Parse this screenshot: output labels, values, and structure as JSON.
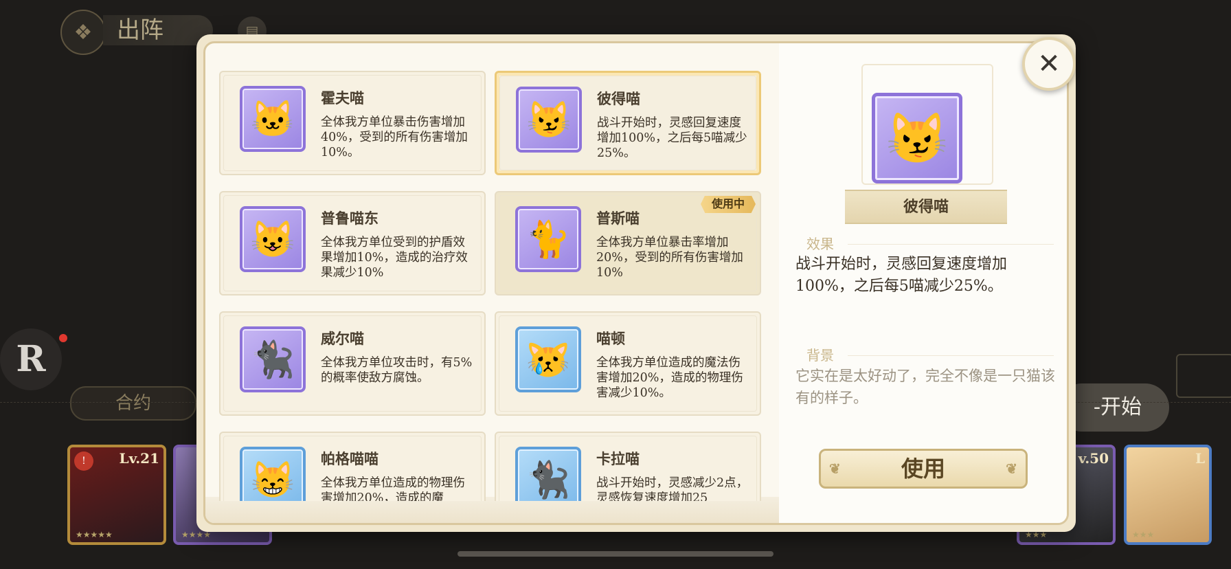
{
  "background": {
    "title": "出阵",
    "contract_label": "合约",
    "start_label": "-开始",
    "r_logo": "R",
    "cards": [
      {
        "level": "Lv.21"
      },
      {
        "level": ""
      },
      {
        "level": "v.50"
      },
      {
        "level": "L"
      }
    ]
  },
  "list": [
    {
      "name": "霍夫喵",
      "desc": "全体我方单位暴击伤害增加40%，受到的所有伤害增加10%。",
      "icon": "cat-icon",
      "frame": "purple",
      "emoji": "🐱"
    },
    {
      "name": "彼得喵",
      "desc": "战斗开始时，灵感回复速度增加100%，之后每5喵减少25%。",
      "icon": "cat-icon",
      "frame": "purple",
      "emoji": "😼",
      "selected": true
    },
    {
      "name": "普鲁喵东",
      "desc": "全体我方单位受到的护盾效果增加10%，造成的治疗效果减少10%",
      "icon": "cat-icon",
      "frame": "purple",
      "emoji": "😺"
    },
    {
      "name": "普斯喵",
      "desc": "全体我方单位暴击率增加20%，受到的所有伤害增加10%",
      "icon": "cat-icon",
      "frame": "purple",
      "emoji": "🐈",
      "tag": "使用中"
    },
    {
      "name": "威尔喵",
      "desc": "全体我方单位攻击时，有5%的概率使敌方腐蚀。",
      "icon": "cat-icon",
      "frame": "purple",
      "emoji": "🐈‍⬛"
    },
    {
      "name": "喵顿",
      "desc": "全体我方单位造成的魔法伤害增加20%，造成的物理伤害减少10%。",
      "icon": "cat-icon",
      "frame": "blue",
      "emoji": "😿"
    },
    {
      "name": "帕格喵喵",
      "desc": "全体我方单位造成的物理伤害增加20%，造成的魔",
      "icon": "cat-icon",
      "frame": "blue",
      "emoji": "😸"
    },
    {
      "name": "卡拉喵",
      "desc": "战斗开始时，灵感减少2点，灵感恢复速度增加25",
      "icon": "cat-icon",
      "frame": "blue",
      "emoji": "🐈‍⬛"
    }
  ],
  "detail": {
    "name": "彼得喵",
    "effect_label": "效果",
    "effect_text": "战斗开始时，灵感回复速度增加100%，之后每5喵减少25%。",
    "background_label": "背景",
    "background_text": "它实在是太好动了，完全不像是一只猫该有的样子。",
    "use_label": "使用",
    "emoji": "😼"
  },
  "close_icon": "✕"
}
